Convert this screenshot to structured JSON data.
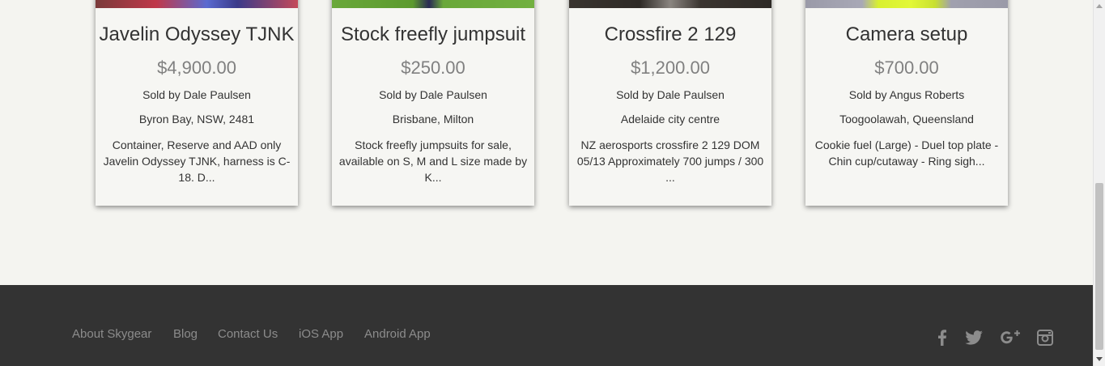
{
  "listings": [
    {
      "title": "Javelin Odyssey TJNK",
      "price": "$4,900.00",
      "seller": "Sold by Dale Paulsen",
      "location": "Byron Bay, NSW, 2481",
      "description": "Container, Reserve and AAD only Javelin Odyssey TJNK, harness is C-18. D..."
    },
    {
      "title": "Stock freefly jumpsuit",
      "price": "$250.00",
      "seller": "Sold by Dale Paulsen",
      "location": "Brisbane, Milton",
      "description": "Stock freefly jumpsuits for sale, available on S, M and L size made by K..."
    },
    {
      "title": "Crossfire 2 129",
      "price": "$1,200.00",
      "seller": "Sold by Dale Paulsen",
      "location": "Adelaide city centre",
      "description": "NZ aerosports crossfire 2 129 DOM 05/13 Approximately 700 jumps / 300 ..."
    },
    {
      "title": "Camera setup",
      "price": "$700.00",
      "seller": "Sold by Angus Roberts",
      "location": "Toogoolawah, Queensland",
      "description": "Cookie fuel (Large) - Duel top plate - Chin cup/cutaway - Ring sigh..."
    }
  ],
  "footer": {
    "links": [
      "About Skygear",
      "Blog",
      "Contact Us",
      "iOS App",
      "Android App"
    ],
    "social_icons": [
      "facebook-icon",
      "twitter-icon",
      "google-plus-icon",
      "instagram-icon"
    ]
  },
  "colors": {
    "background": "#f4f4f0",
    "footer_bg": "#333333",
    "footer_text": "#8c8c8c",
    "price": "#808080"
  }
}
